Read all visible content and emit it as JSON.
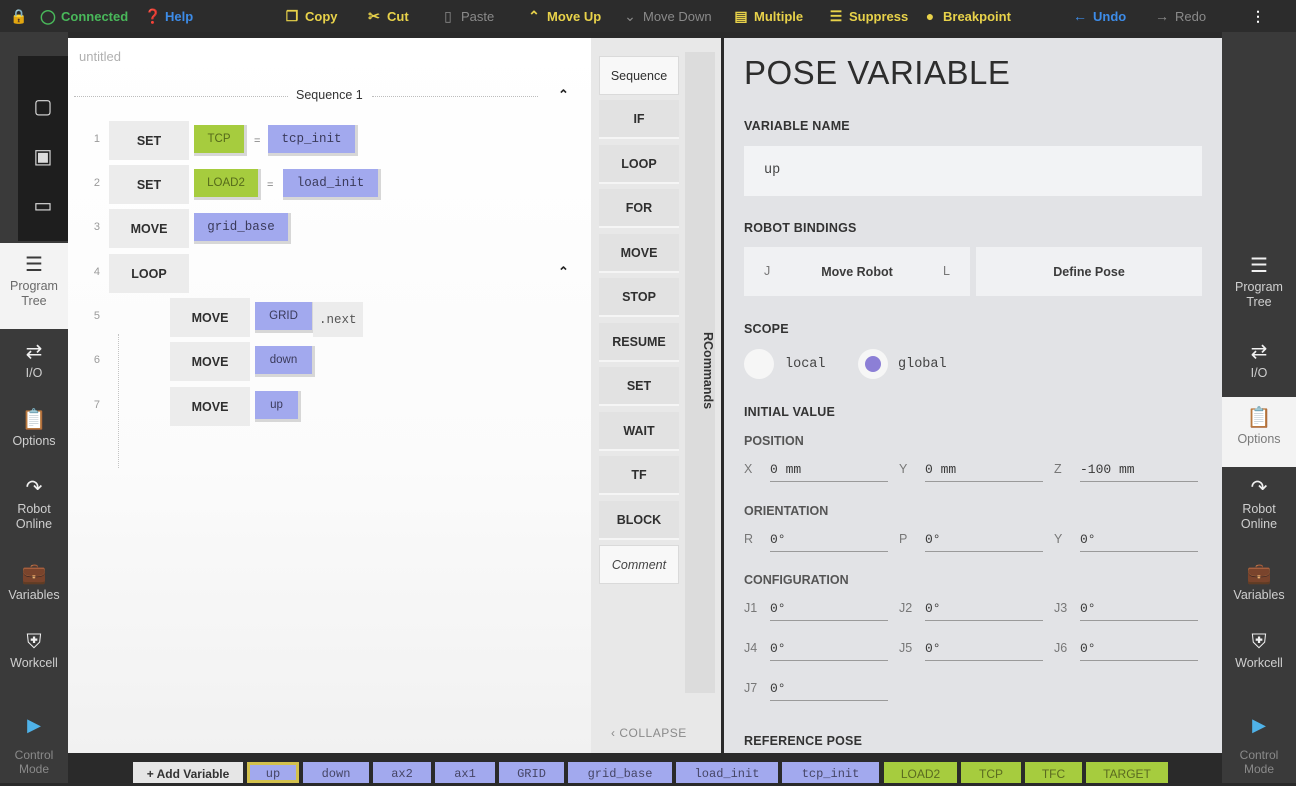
{
  "topbar": {
    "connected": "Connected",
    "help": "Help",
    "copy": "Copy",
    "cut": "Cut",
    "paste": "Paste",
    "move_up": "Move Up",
    "move_down": "Move Down",
    "multiple": "Multiple",
    "suppress": "Suppress",
    "breakpoint": "Breakpoint",
    "undo": "Undo",
    "redo": "Redo"
  },
  "left_nav": [
    {
      "label": "Program Tree",
      "icon": "list-icon",
      "active": true
    },
    {
      "label": "I/O",
      "icon": "io-arrows-icon",
      "active": false
    },
    {
      "label": "Options",
      "icon": "clipboard-icon",
      "active": false
    },
    {
      "label": "Robot Online",
      "icon": "robot-arm-icon",
      "active": false
    },
    {
      "label": "Variables",
      "icon": "briefcase-icon",
      "active": false
    },
    {
      "label": "Workcell",
      "icon": "shield-icon",
      "active": false
    }
  ],
  "right_nav": [
    {
      "label": "Program Tree",
      "icon": "list-icon",
      "active": false
    },
    {
      "label": "I/O",
      "icon": "io-arrows-icon",
      "active": false
    },
    {
      "label": "Options",
      "icon": "clipboard-icon",
      "active": true
    },
    {
      "label": "Robot Online",
      "icon": "robot-arm-icon",
      "active": false
    },
    {
      "label": "Variables",
      "icon": "briefcase-icon",
      "active": false
    },
    {
      "label": "Workcell",
      "icon": "shield-icon",
      "active": false
    }
  ],
  "control_mode": "Control Mode",
  "editor": {
    "title": "untitled",
    "sequence_label": "Sequence 1",
    "rows": [
      {
        "n": "1",
        "kw": "SET",
        "a": "TCP",
        "op": "=",
        "b": "tcp_init"
      },
      {
        "n": "2",
        "kw": "SET",
        "a": "LOAD2",
        "op": "=",
        "b": "load_init"
      },
      {
        "n": "3",
        "kw": "MOVE",
        "a": "grid_base"
      },
      {
        "n": "4",
        "kw": "LOOP"
      },
      {
        "n": "5",
        "kw": "MOVE",
        "a": "GRID",
        "suffix": ".next"
      },
      {
        "n": "6",
        "kw": "MOVE",
        "a": "down"
      },
      {
        "n": "7",
        "kw": "MOVE",
        "a": "up"
      }
    ]
  },
  "commands": {
    "items": [
      "Sequence",
      "IF",
      "LOOP",
      "FOR",
      "MOVE",
      "STOP",
      "RESUME",
      "SET",
      "WAIT",
      "TF",
      "BLOCK",
      "Comment"
    ],
    "rcommands": "RCommands",
    "collapse": "COLLAPSE"
  },
  "pose": {
    "title": "POSE VARIABLE",
    "variable_name_label": "VARIABLE NAME",
    "variable_name": "up",
    "bindings_label": "ROBOT BINDINGS",
    "bind_j": "J",
    "bind_move": "Move Robot",
    "bind_l": "L",
    "define_pose": "Define Pose",
    "scope_label": "SCOPE",
    "scope_local": "local",
    "scope_global": "global",
    "scope_selected": "global",
    "initial_value_label": "INITIAL VALUE",
    "position_label": "POSITION",
    "position": {
      "x_label": "X",
      "x": "0 mm",
      "y_label": "Y",
      "y": "0 mm",
      "z_label": "Z",
      "z": "-100 mm"
    },
    "orientation_label": "ORIENTATION",
    "orientation": {
      "r_label": "R",
      "r": "0°",
      "p_label": "P",
      "p": "0°",
      "y_label": "Y",
      "y": "0°"
    },
    "configuration_label": "CONFIGURATION",
    "configuration": [
      {
        "label": "J1",
        "value": "0°"
      },
      {
        "label": "J2",
        "value": "0°"
      },
      {
        "label": "J3",
        "value": "0°"
      },
      {
        "label": "J4",
        "value": "0°"
      },
      {
        "label": "J5",
        "value": "0°"
      },
      {
        "label": "J6",
        "value": "0°"
      },
      {
        "label": "J7",
        "value": "0°"
      }
    ],
    "reference_pose_label": "REFERENCE POSE"
  },
  "variables_bar": {
    "add_label": "+ Add Variable",
    "chips": [
      {
        "name": "up",
        "kind": "pose",
        "selected": true
      },
      {
        "name": "down",
        "kind": "pose"
      },
      {
        "name": "ax2",
        "kind": "pose"
      },
      {
        "name": "ax1",
        "kind": "pose"
      },
      {
        "name": "GRID",
        "kind": "pose"
      },
      {
        "name": "grid_base",
        "kind": "pose"
      },
      {
        "name": "load_init",
        "kind": "pose"
      },
      {
        "name": "tcp_init",
        "kind": "pose"
      },
      {
        "name": "LOAD2",
        "kind": "tool"
      },
      {
        "name": "TCP",
        "kind": "tool"
      },
      {
        "name": "TFC",
        "kind": "tool"
      },
      {
        "name": "TARGET",
        "kind": "tool"
      }
    ]
  },
  "colors": {
    "accent_yellow": "#e8d24a",
    "connected_green": "#49b85a",
    "undo_blue": "#3d8ce8",
    "pose_chip": "#a2a9ee",
    "tool_chip": "#a6cc3e",
    "scope_radio": "#8c7fd6"
  }
}
